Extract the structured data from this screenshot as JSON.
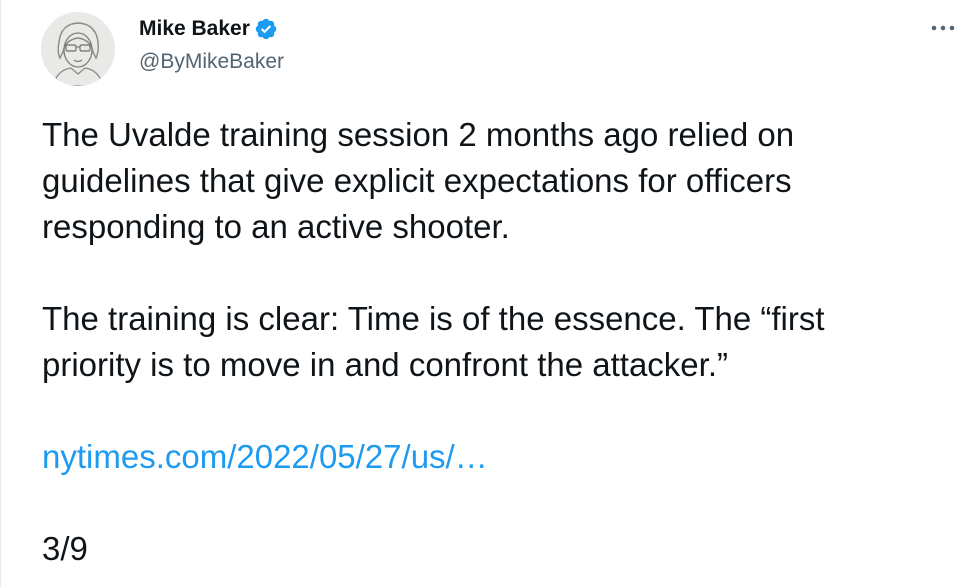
{
  "author": {
    "name": "Mike Baker",
    "handle": "@ByMikeBaker",
    "verified_color": "#1d9bf0",
    "verified_icon": "verified-badge-icon",
    "avatar_icon": "sketch-portrait-avatar"
  },
  "menu": {
    "icon": "more-horizontal-icon",
    "glyph": "···"
  },
  "tweet": {
    "paragraph_1_line_1": "The Uvalde training session 2 months ago relied on",
    "paragraph_1_line_2": "guidelines that give explicit expectations for officers",
    "paragraph_1_line_3": "responding to an active shooter.",
    "paragraph_2_line_1": "The training is clear: Time is of the essence. The “first",
    "paragraph_2_line_2": "priority is to move in and confront the attacker.”",
    "link_text": "nytimes.com/2022/05/27/us/…",
    "link_color": "#1d9bf0",
    "thread_position": "3/9"
  }
}
